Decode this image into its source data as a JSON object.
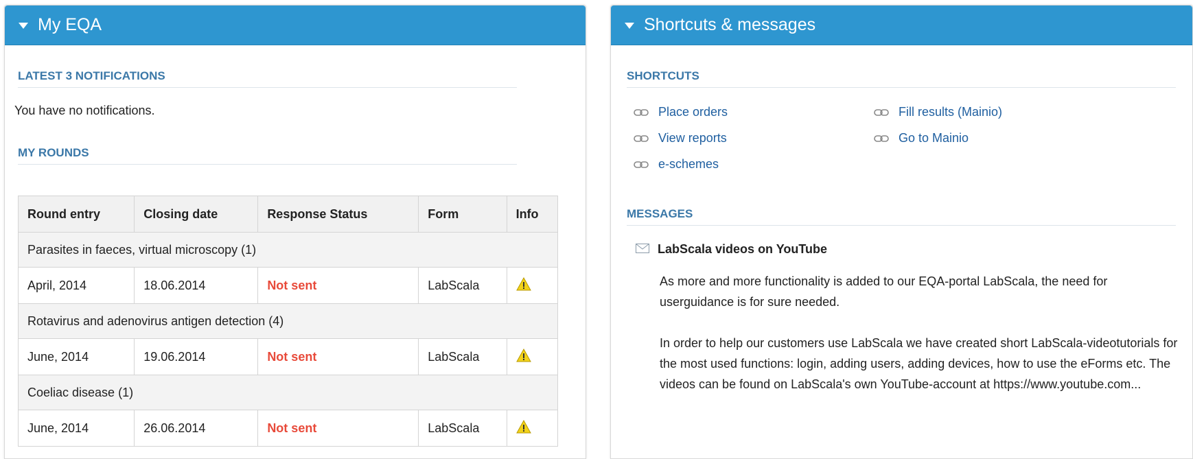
{
  "left_panel": {
    "title": "My EQA",
    "notifications_heading": "LATEST 3 NOTIFICATIONS",
    "notifications_text": "You have no notifications.",
    "rounds_heading": "MY ROUNDS",
    "table": {
      "headers": [
        "Round entry",
        "Closing date",
        "Response Status",
        "Form",
        "Info"
      ],
      "groups": [
        {
          "name": "Parasites in faeces, virtual microscopy (1)",
          "round_entry": "April, 2014",
          "closing_date": "18.06.2014",
          "status": "Not sent",
          "form": "LabScala",
          "info_icon": "warning-icon"
        },
        {
          "name": "Rotavirus and adenovirus antigen detection (4)",
          "round_entry": "June, 2014",
          "closing_date": "19.06.2014",
          "status": "Not sent",
          "form": "LabScala",
          "info_icon": "warning-icon"
        },
        {
          "name": "Coeliac disease (1)",
          "round_entry": "June, 2014",
          "closing_date": "26.06.2014",
          "status": "Not sent",
          "form": "LabScala",
          "info_icon": "warning-icon"
        }
      ]
    }
  },
  "right_panel": {
    "title": "Shortcuts & messages",
    "shortcuts_heading": "SHORTCUTS",
    "shortcuts": {
      "place_orders": "Place orders",
      "view_reports": "View reports",
      "e_schemes": "e-schemes",
      "fill_results": "Fill results (Mainio)",
      "go_to_mainio": "Go to Mainio"
    },
    "messages_heading": "MESSAGES",
    "message": {
      "title": "LabScala videos on YouTube",
      "paragraph1": "As more and more functionality is added to our EQA-portal LabScala, the need for userguidance is for sure needed.",
      "paragraph2": "In order to help our customers use LabScala we have created short LabScala-videotutorials for the most used functions: login, adding users, adding devices, how to use the eForms etc. The videos can be found on LabScala's own YouTube-account at https://www.youtube.com..."
    }
  },
  "colors": {
    "header_blue": "#2e96d0",
    "section_title": "#3b78a8",
    "link": "#1f5fa0",
    "not_sent": "#e84a3a",
    "warning": "#f2d21a"
  }
}
